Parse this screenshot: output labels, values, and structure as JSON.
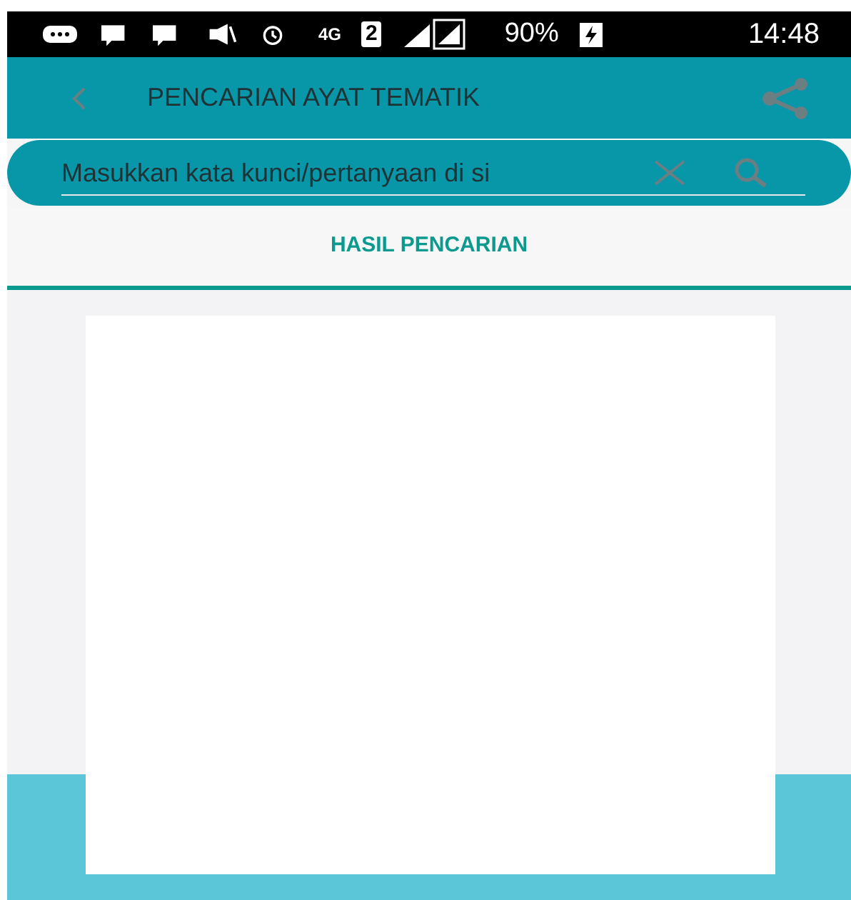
{
  "status_bar": {
    "network": "4G",
    "sim": "2",
    "battery": "90%",
    "time": "14:48"
  },
  "toolbar": {
    "title": "PENCARIAN AYAT TEMATIK"
  },
  "search": {
    "value": "Masukkan kata kunci/pertanyaan di si"
  },
  "tabs": [
    {
      "label": "HASIL PENCARIAN",
      "selected": true
    }
  ]
}
